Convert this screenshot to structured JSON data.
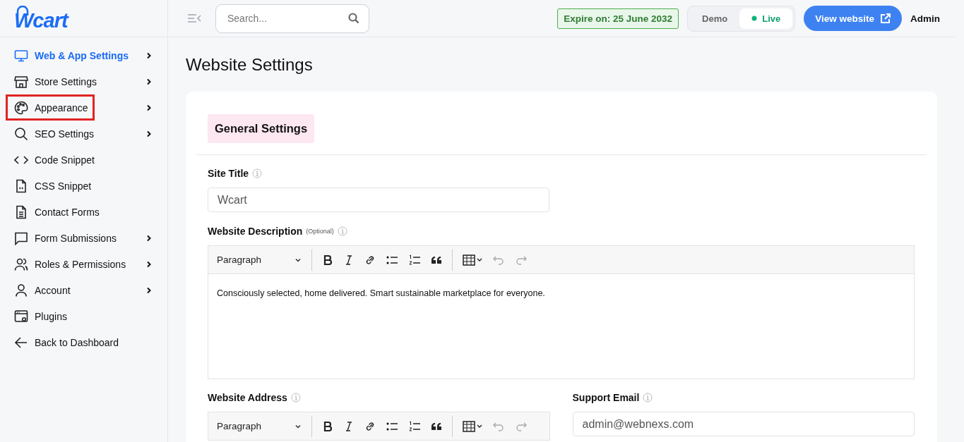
{
  "logo": {
    "text": "Wcart"
  },
  "sidebar": {
    "items": [
      {
        "label": "Web & App Settings",
        "has_submenu": true,
        "selected": true,
        "highlighted": false
      },
      {
        "label": "Store Settings",
        "has_submenu": true,
        "selected": false,
        "highlighted": false
      },
      {
        "label": "Appearance",
        "has_submenu": true,
        "selected": false,
        "highlighted": true
      },
      {
        "label": "SEO Settings",
        "has_submenu": true,
        "selected": false,
        "highlighted": false
      },
      {
        "label": "Code Snippet",
        "has_submenu": false,
        "selected": false,
        "highlighted": false
      },
      {
        "label": "CSS Snippet",
        "has_submenu": false,
        "selected": false,
        "highlighted": false
      },
      {
        "label": "Contact Forms",
        "has_submenu": false,
        "selected": false,
        "highlighted": false
      },
      {
        "label": "Form Submissions",
        "has_submenu": true,
        "selected": false,
        "highlighted": false
      },
      {
        "label": "Roles & Permissions",
        "has_submenu": true,
        "selected": false,
        "highlighted": false
      },
      {
        "label": "Account",
        "has_submenu": true,
        "selected": false,
        "highlighted": false
      },
      {
        "label": "Plugins",
        "has_submenu": false,
        "selected": false,
        "highlighted": false
      },
      {
        "label": "Back to Dashboard",
        "has_submenu": false,
        "selected": false,
        "highlighted": false
      }
    ]
  },
  "header": {
    "search": {
      "placeholder": "Search..."
    },
    "expiry": "Expire on: 25 June 2032",
    "mode_toggle": [
      {
        "label": "Demo",
        "selected": false
      },
      {
        "label": "Live",
        "selected": true
      }
    ],
    "view_button": "View website",
    "user": "Admin"
  },
  "page_title": "Website Settings",
  "card": {
    "section_tab": "General Settings",
    "site_title": {
      "label": "Site Title",
      "value": "Wcart"
    },
    "description": {
      "label": "Website Description",
      "note": "(Optional)",
      "format": "Paragraph",
      "content": "Consciously selected, home delivered. Smart sustainable marketplace for everyone."
    },
    "address": {
      "label": "Website Address",
      "format": "Paragraph"
    },
    "support_email": {
      "label": "Support Email",
      "value": "admin@webnexs.com"
    }
  }
}
